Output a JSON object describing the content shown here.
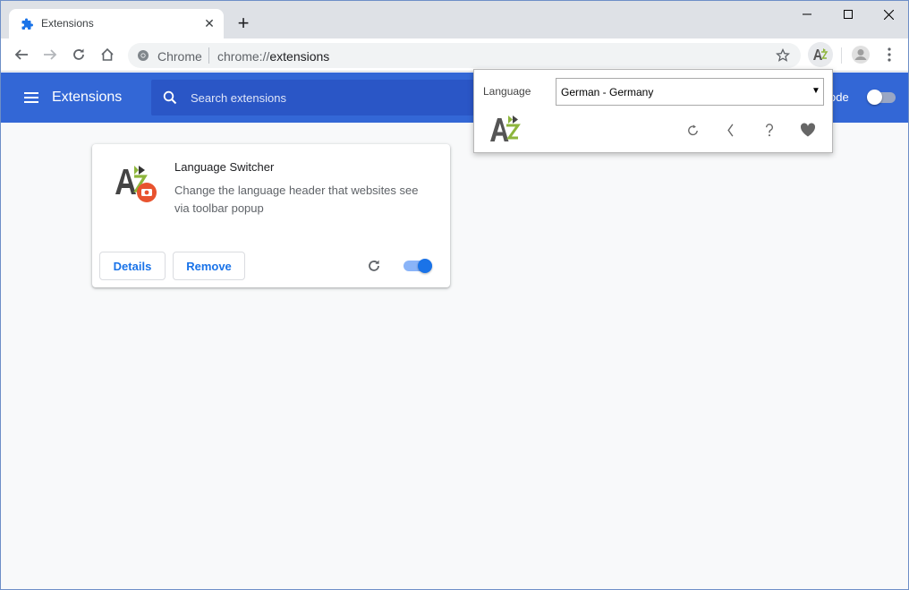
{
  "tab": {
    "title": "Extensions"
  },
  "omnibox": {
    "scheme_label": "Chrome",
    "url_scheme": "chrome://",
    "url_host": "extensions"
  },
  "header": {
    "title": "Extensions",
    "search_placeholder": "Search extensions",
    "devmode_label_visible": "ode",
    "devmode_enabled": false
  },
  "extension": {
    "name": "Language Switcher",
    "description": "Change the language header that websites see via toolbar popup",
    "details_label": "Details",
    "remove_label": "Remove",
    "enabled": true
  },
  "popup": {
    "language_label": "Language",
    "selected_language": "German - Germany"
  },
  "colors": {
    "header_bg": "#3367d6",
    "search_bg": "#2a56c6",
    "accent_blue": "#1a73e8",
    "logo_gray": "#555555",
    "logo_green": "#8db53c",
    "badge_red": "#e8532f"
  },
  "icons": {
    "tab_favicon": "puzzle-piece-icon",
    "window_controls": [
      "minimize-icon",
      "maximize-icon",
      "close-icon"
    ],
    "toolbar": [
      "back-arrow-icon",
      "forward-arrow-icon",
      "reload-icon",
      "home-icon",
      "star-icon",
      "extension-action-icon",
      "profile-icon",
      "more-vert-icon"
    ],
    "popup": [
      "refresh-icon",
      "back-chevron-icon",
      "help-icon",
      "heart-icon"
    ]
  }
}
